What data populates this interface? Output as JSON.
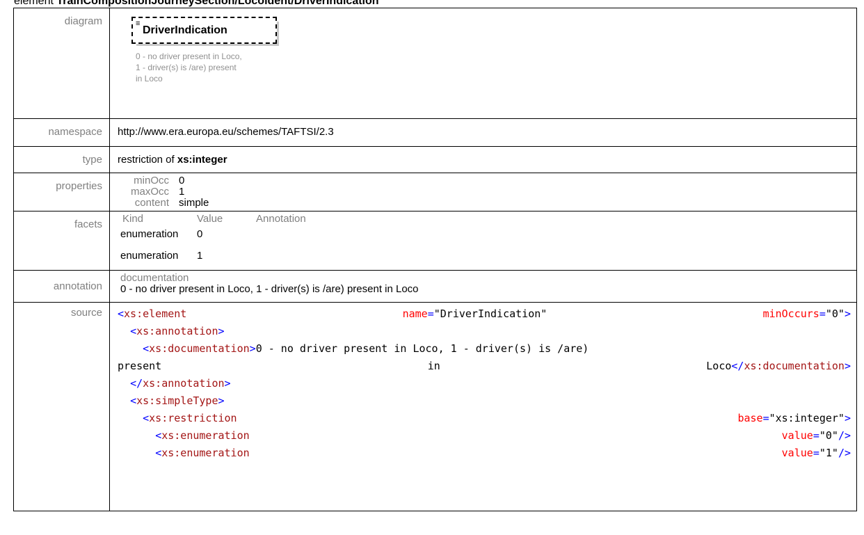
{
  "header": {
    "prefix": "element ",
    "path": "TrainCompositionJourneySection/Locoident/DriverIndication"
  },
  "rows": {
    "diagram": {
      "label": "diagram",
      "element_name": "DriverIndication",
      "icon": "documentation-lines-icon",
      "doc_lines": [
        "0 - no driver present in Loco,",
        "1 - driver(s) is /are) present",
        "in Loco"
      ]
    },
    "namespace": {
      "label": "namespace",
      "value": "http://www.era.europa.eu/schemes/TAFTSI/2.3"
    },
    "type": {
      "label": "type",
      "prefix": "restriction of ",
      "base": "xs:integer"
    },
    "properties": {
      "label": "properties",
      "items": [
        {
          "key": "minOcc",
          "value": "0"
        },
        {
          "key": "maxOcc",
          "value": "1"
        },
        {
          "key": "content",
          "value": "simple"
        }
      ]
    },
    "facets": {
      "label": "facets",
      "headers": [
        "Kind",
        "Value",
        "Annotation"
      ],
      "rows": [
        {
          "kind": "enumeration",
          "value": "0"
        },
        {
          "kind": "enumeration",
          "value": "1"
        }
      ]
    },
    "annotation": {
      "label": "annotation",
      "heading": "documentation",
      "text": "0 - no driver present in Loco, 1 - driver(s) is /are) present in Loco"
    },
    "source": {
      "label": "source",
      "lines": [
        {
          "indent": "",
          "parts": [
            [
              {
                "c": "tg",
                "t": "<"
              },
              {
                "c": "tn",
                "t": "xs:element"
              }
            ],
            [
              {
                "c": "at",
                "t": "name"
              },
              {
                "c": "tg",
                "t": "="
              },
              {
                "c": "tx",
                "t": "\"DriverIndication\""
              }
            ],
            [
              {
                "c": "at",
                "t": "minOccurs"
              },
              {
                "c": "tg",
                "t": "="
              },
              {
                "c": "tx",
                "t": "\"0\""
              },
              {
                "c": "tg",
                "t": ">"
              }
            ]
          ]
        },
        {
          "indent": "  ",
          "left": true,
          "parts": [
            [
              {
                "c": "tg",
                "t": "<"
              },
              {
                "c": "tn",
                "t": "xs:annotation"
              },
              {
                "c": "tg",
                "t": ">"
              }
            ]
          ]
        },
        {
          "indent": "    ",
          "left": true,
          "parts": [
            [
              {
                "c": "tg",
                "t": "<"
              },
              {
                "c": "tn",
                "t": "xs:documentation"
              },
              {
                "c": "tg",
                "t": ">"
              },
              {
                "c": "tx",
                "t": "0 - no driver present in Loco, 1 - driver(s) is /are)"
              }
            ]
          ]
        },
        {
          "indent": "",
          "parts": [
            [
              {
                "c": "tx",
                "t": "present"
              }
            ],
            [
              {
                "c": "tx",
                "t": "in"
              }
            ],
            [
              {
                "c": "tx",
                "t": "Loco"
              },
              {
                "c": "tg",
                "t": "</"
              },
              {
                "c": "tn",
                "t": "xs:documentation"
              },
              {
                "c": "tg",
                "t": ">"
              }
            ]
          ]
        },
        {
          "indent": "  ",
          "left": true,
          "parts": [
            [
              {
                "c": "tg",
                "t": "</"
              },
              {
                "c": "tn",
                "t": "xs:annotation"
              },
              {
                "c": "tg",
                "t": ">"
              }
            ]
          ]
        },
        {
          "indent": "  ",
          "left": true,
          "parts": [
            [
              {
                "c": "tg",
                "t": "<"
              },
              {
                "c": "tn",
                "t": "xs:simpleType"
              },
              {
                "c": "tg",
                "t": ">"
              }
            ]
          ]
        },
        {
          "indent": "    ",
          "parts": [
            [
              {
                "c": "tg",
                "t": "<"
              },
              {
                "c": "tn",
                "t": "xs:restriction"
              }
            ],
            [
              {
                "c": "at",
                "t": "base"
              },
              {
                "c": "tg",
                "t": "="
              },
              {
                "c": "tx",
                "t": "\"xs:integer\""
              },
              {
                "c": "tg",
                "t": ">"
              }
            ]
          ]
        },
        {
          "indent": "      ",
          "parts": [
            [
              {
                "c": "tg",
                "t": "<"
              },
              {
                "c": "tn",
                "t": "xs:enumeration"
              }
            ],
            [
              {
                "c": "at",
                "t": "value"
              },
              {
                "c": "tg",
                "t": "="
              },
              {
                "c": "tx",
                "t": "\"0\""
              },
              {
                "c": "tg",
                "t": "/>"
              }
            ]
          ]
        },
        {
          "indent": "      ",
          "parts": [
            [
              {
                "c": "tg",
                "t": "<"
              },
              {
                "c": "tn",
                "t": "xs:enumeration"
              }
            ],
            [
              {
                "c": "at",
                "t": "value"
              },
              {
                "c": "tg",
                "t": "="
              },
              {
                "c": "tx",
                "t": "\"1\""
              },
              {
                "c": "tg",
                "t": "/>"
              }
            ]
          ]
        }
      ]
    }
  },
  "colors": {
    "tag": "#0000ff",
    "tag_name": "#a31515",
    "attr_name": "#ff0000",
    "label": "#808080"
  }
}
